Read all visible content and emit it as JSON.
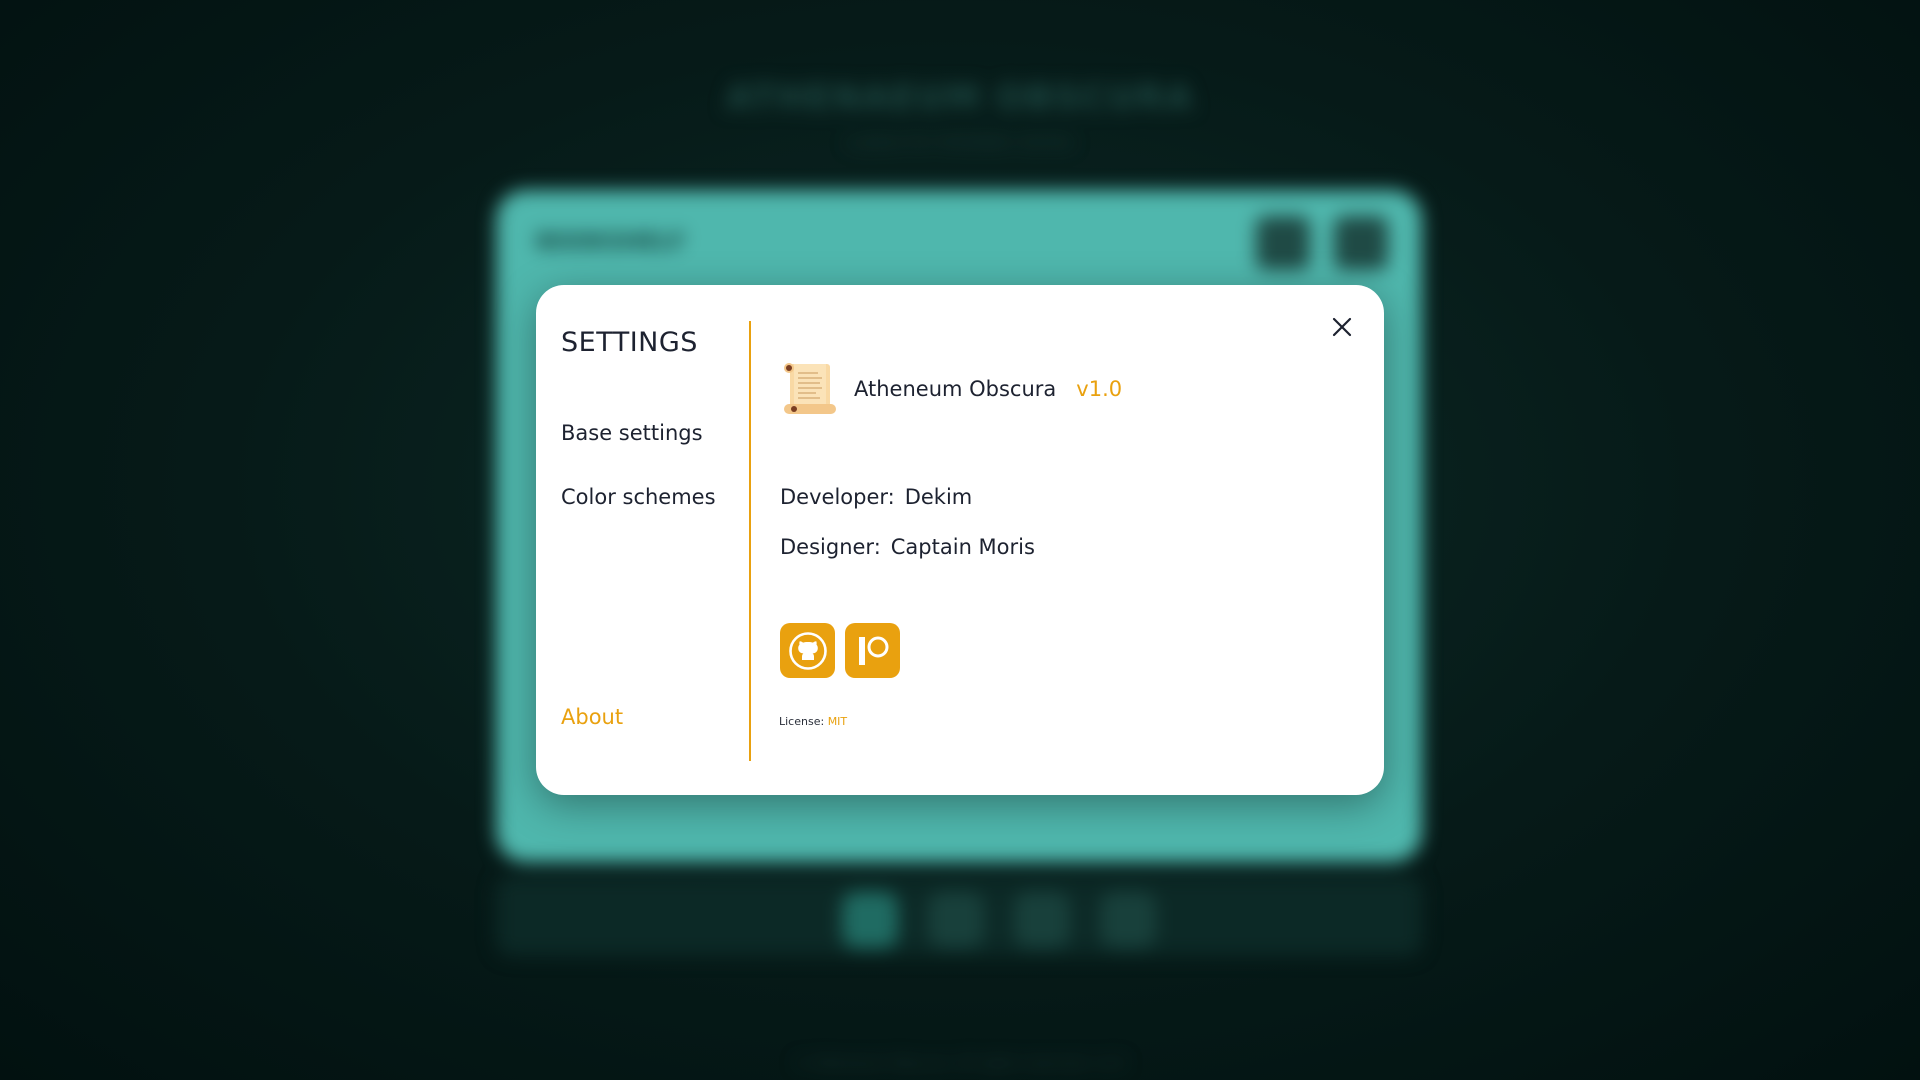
{
  "background_app": {
    "title": "ATHENAEUM OBSCURA",
    "subtitle": "a place for forbidden stories",
    "card_title": "BOOKSHELF",
    "footer": "© Atheneum Obscura. All rights reserved. v1.0",
    "accent_color": "#4fb7ad"
  },
  "settings_modal": {
    "heading": "SETTINGS",
    "nav": {
      "base_settings": "Base settings",
      "color_schemes": "Color schemes",
      "about": "About"
    },
    "active_section": "About",
    "close_icon": "close-icon"
  },
  "about": {
    "app_icon": "scroll-icon",
    "app_name": "Atheneum Obscura",
    "version": "v1.0",
    "developer_label": "Developer:",
    "developer": "Dekim",
    "designer_label": "Designer:",
    "designer": "Captain Moris",
    "links": [
      {
        "icon": "github-icon"
      },
      {
        "icon": "patreon-icon"
      }
    ],
    "license_label": "License:",
    "license": "MIT"
  },
  "colors": {
    "accent": "#e9a10f",
    "text": "#1d2230",
    "modal_bg": "#ffffff"
  }
}
